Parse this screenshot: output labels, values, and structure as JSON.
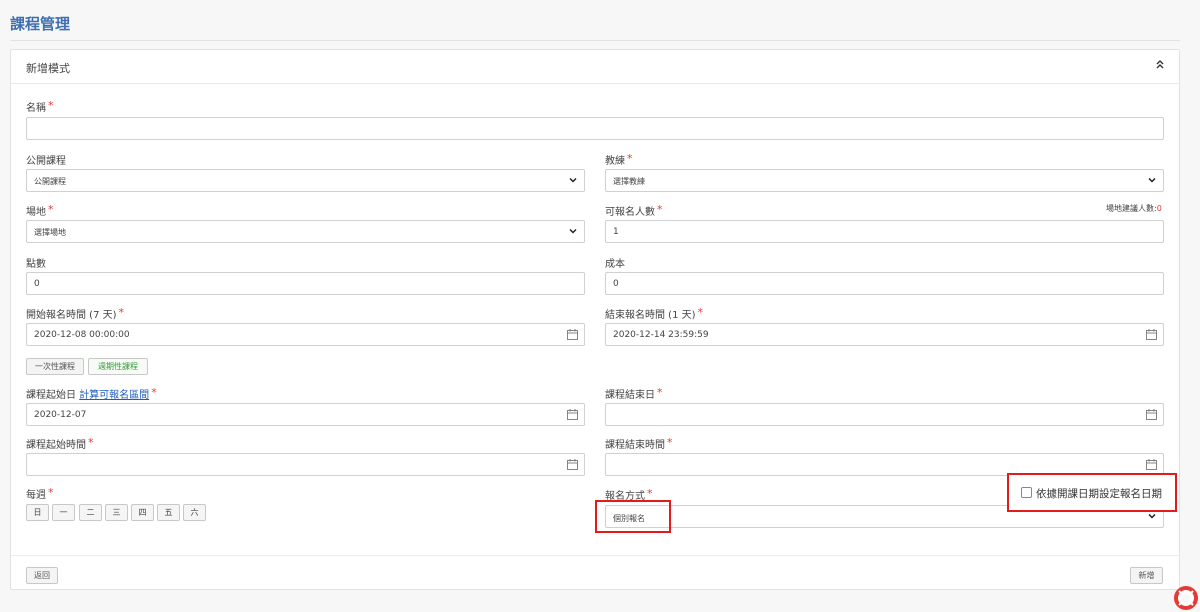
{
  "page": {
    "title": "課程管理"
  },
  "panel": {
    "title": "新增模式",
    "collapse_icon": "chevron-double-up-icon"
  },
  "form": {
    "name": {
      "label": "名稱",
      "required": "*",
      "value": ""
    },
    "public_course": {
      "label": "公開課程",
      "value": "公開課程"
    },
    "coach": {
      "label": "教練",
      "required": "*",
      "value": "選擇教練"
    },
    "venue": {
      "label": "場地",
      "required": "*",
      "value": "選擇場地"
    },
    "capacity": {
      "label": "可報名人數",
      "required": "*",
      "value": "1",
      "hint_label": "場地建議人數:",
      "hint_value": "0"
    },
    "points": {
      "label": "點數",
      "value": "0"
    },
    "cost": {
      "label": "成本",
      "value": "0"
    },
    "reg_start": {
      "label": "開始報名時間 (7 天)",
      "required": "*",
      "value": "2020-12-08 00:00:00"
    },
    "reg_end": {
      "label": "結束報名時間 (1 天)",
      "required": "*",
      "value": "2020-12-14 23:59:59"
    },
    "course_type_buttons": {
      "one_time": "一次性課程",
      "periodic": "週期性課程"
    },
    "course_start_date": {
      "label": "課程起始日",
      "link": "計算可報名區間",
      "required": "*",
      "value": "2020-12-07"
    },
    "course_end_date": {
      "label": "課程結束日",
      "required": "*",
      "value": ""
    },
    "course_start_time": {
      "label": "課程起始時間",
      "required": "*",
      "value": ""
    },
    "course_end_time": {
      "label": "課程結束時間",
      "required": "*",
      "value": ""
    },
    "weekly": {
      "label": "每週",
      "required": "*",
      "days": [
        "日",
        "一",
        "二",
        "三",
        "四",
        "五",
        "六"
      ]
    },
    "reg_method": {
      "label": "報名方式",
      "required": "*",
      "value": "個別報名"
    },
    "auto_reg_date": {
      "label": "依據開課日期設定報名日期",
      "checked": false
    }
  },
  "footer": {
    "back_label": "返回",
    "submit_label": "新增"
  },
  "colors": {
    "accent": "#3f6fb0",
    "required": "#e53935",
    "highlight": "#e31b1b",
    "link": "#1f5ebd"
  }
}
